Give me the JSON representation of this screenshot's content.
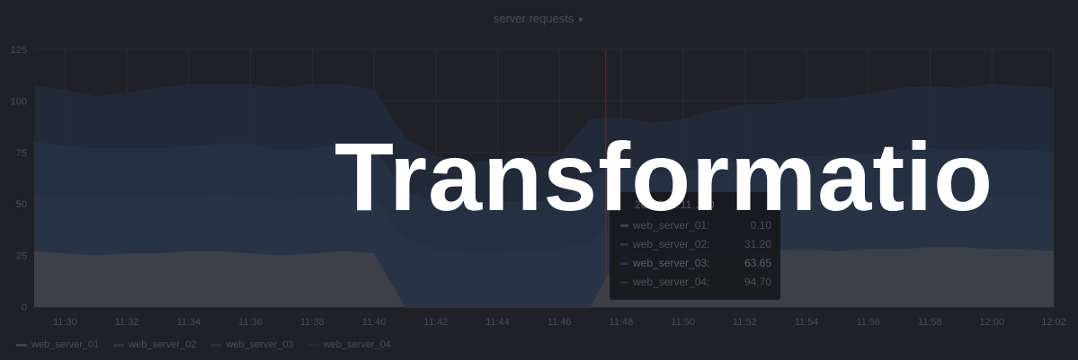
{
  "colors": {
    "background": "#1f2127",
    "grid": "#292c33",
    "axis_text": "#4a4d55",
    "series": [
      "#3f424a",
      "#2a3548",
      "#273245",
      "#232a3a"
    ]
  },
  "overlay": {
    "title": "Transformatio"
  },
  "tooltip": {
    "time": "20…06…11…40",
    "rows": [
      {
        "name": "web_server_01:",
        "value": "0.10",
        "highlight": false
      },
      {
        "name": "web_server_02:",
        "value": "31.20",
        "highlight": false
      },
      {
        "name": "web_server_03:",
        "value": "63.65",
        "highlight": true
      },
      {
        "name": "web_server_04:",
        "value": "94.70",
        "highlight": false
      }
    ]
  },
  "chart_data": {
    "type": "area",
    "stacked": true,
    "title": "server requests",
    "xlabel": "",
    "ylabel": "",
    "ylim": [
      0,
      125
    ],
    "yticks": [
      0,
      25,
      50,
      75,
      100,
      125
    ],
    "xticks": [
      "11:30",
      "11:32",
      "11:34",
      "11:36",
      "11:38",
      "11:40",
      "11:42",
      "11:44",
      "11:46",
      "11:48",
      "11:50",
      "11:52",
      "11:54",
      "11:56",
      "11:58",
      "12:00",
      "12:02"
    ],
    "x": [
      "11:29",
      "11:30",
      "11:31",
      "11:32",
      "11:33",
      "11:34",
      "11:35",
      "11:36",
      "11:37",
      "11:38",
      "11:39",
      "11:40",
      "11:41",
      "11:42",
      "11:43",
      "11:44",
      "11:45",
      "11:46",
      "11:47",
      "11:48",
      "11:49",
      "11:50",
      "11:51",
      "11:52",
      "11:53",
      "11:54",
      "11:55",
      "11:56",
      "11:57",
      "11:58",
      "11:59",
      "12:00",
      "12:01",
      "12:02"
    ],
    "series": [
      {
        "name": "web_server_01",
        "values": [
          27,
          26,
          25,
          26,
          26,
          27,
          27,
          26,
          25,
          26,
          27,
          26,
          0,
          0,
          0,
          0,
          0,
          0,
          0,
          27,
          26,
          25,
          27,
          28,
          27,
          28,
          27,
          28,
          28,
          29,
          29,
          28,
          28,
          27
        ]
      },
      {
        "name": "web_server_02",
        "values": [
          27,
          27,
          28,
          27,
          28,
          27,
          28,
          28,
          27,
          27,
          28,
          27,
          33,
          28,
          27,
          27,
          28,
          28,
          31,
          24,
          23,
          22,
          23,
          24,
          24,
          24,
          24,
          24,
          25,
          24,
          24,
          25,
          25,
          25
        ]
      },
      {
        "name": "web_server_03",
        "values": [
          26,
          25,
          24,
          24,
          23,
          24,
          24,
          25,
          24,
          24,
          24,
          24,
          23,
          23,
          24,
          24,
          23,
          23,
          32,
          19,
          16,
          18,
          19,
          19,
          20,
          21,
          22,
          22,
          23,
          24,
          23,
          24,
          23,
          23
        ]
      },
      {
        "name": "web_server_04",
        "values": [
          27,
          27,
          25,
          27,
          29,
          30,
          29,
          29,
          30,
          31,
          29,
          28,
          26,
          22,
          19,
          20,
          22,
          22,
          28,
          22,
          24,
          26,
          26,
          27,
          27,
          28,
          28,
          29,
          30,
          30,
          30,
          31,
          31,
          31
        ]
      }
    ],
    "legend": {
      "position": "bottom-left",
      "entries": [
        "web_server_01",
        "web_server_02",
        "web_server_03",
        "web_server_04"
      ]
    },
    "grid": true
  }
}
